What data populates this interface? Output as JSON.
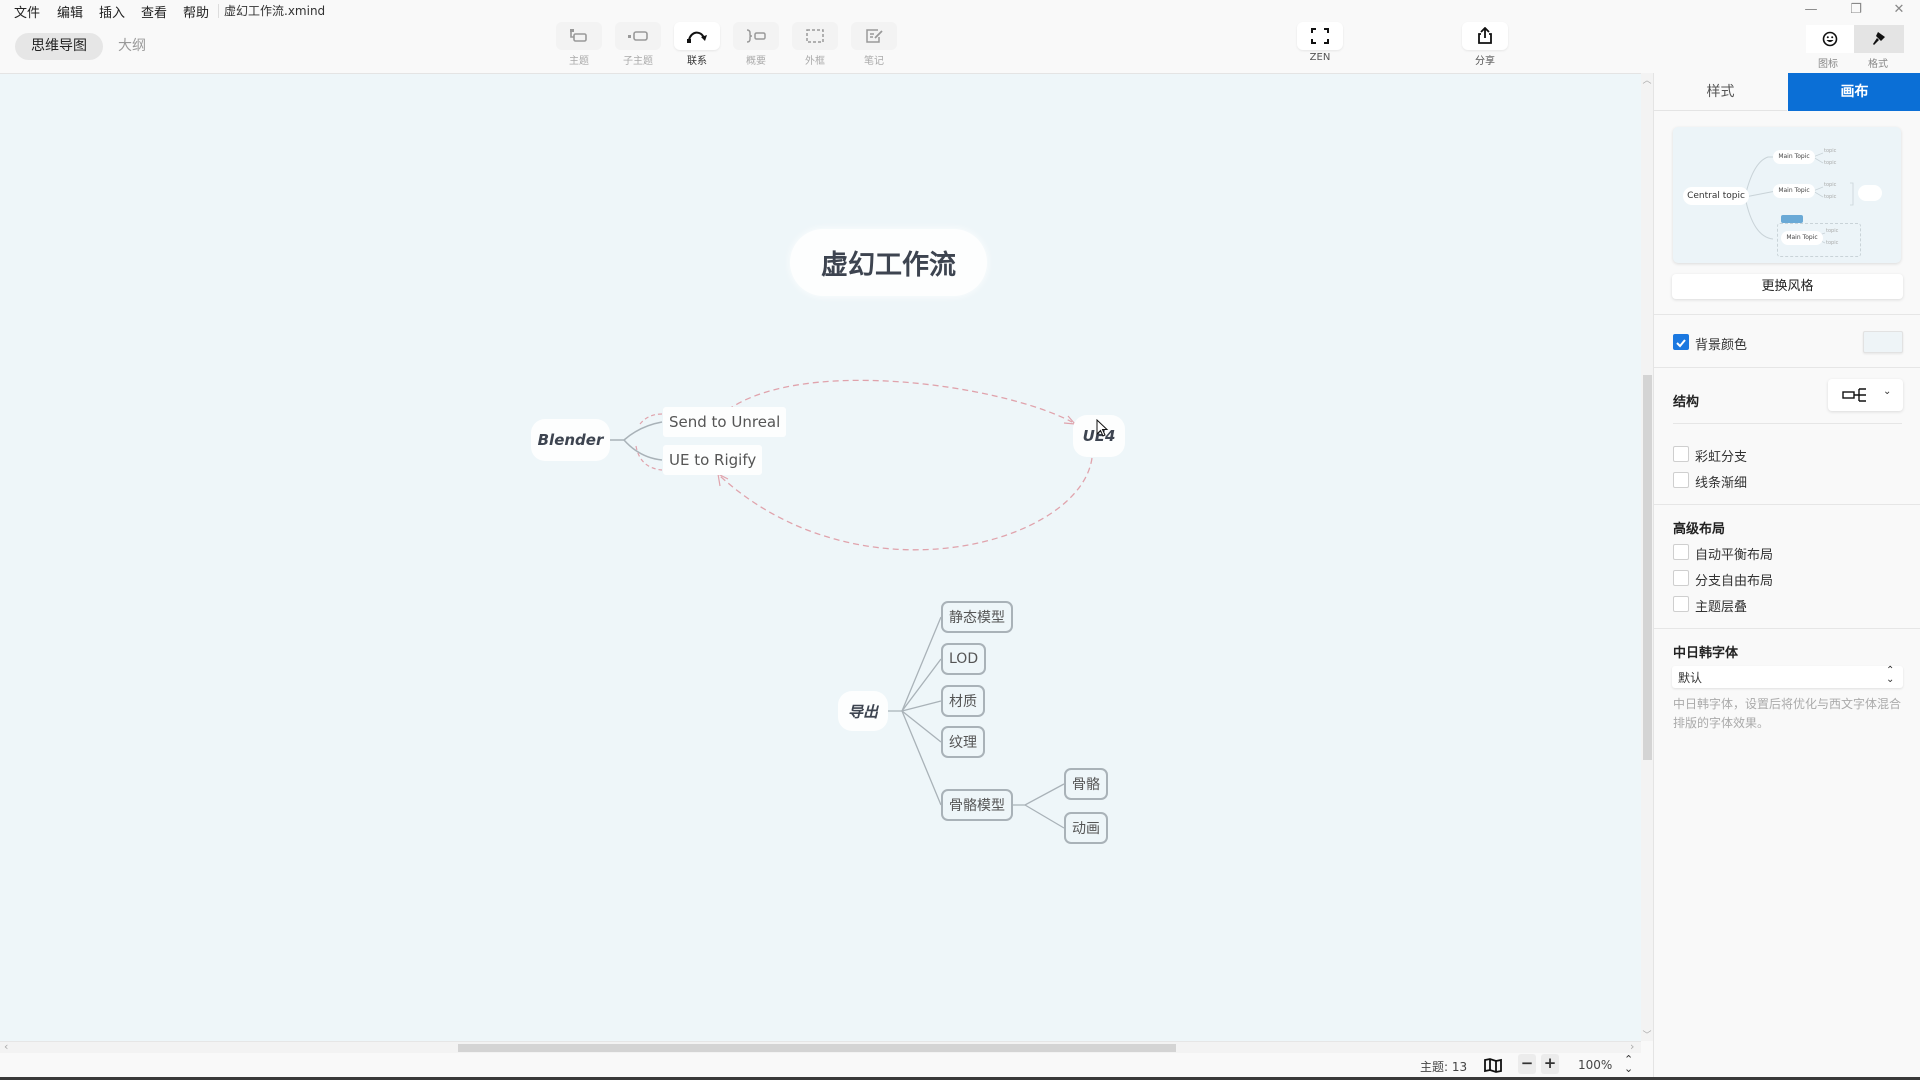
{
  "menubar": {
    "items": [
      "文件",
      "编辑",
      "插入",
      "查看",
      "帮助"
    ],
    "filename": "虚幻工作流.xmind",
    "window_controls": {
      "minimize": "—",
      "restore": "❐",
      "close": "✕"
    }
  },
  "view_tabs": {
    "mindmap": "思维导图",
    "outline": "大纲",
    "active": "mindmap"
  },
  "toolbar": {
    "items": [
      {
        "label": "主题",
        "icon": "topic-icon",
        "active": false
      },
      {
        "label": "子主题",
        "icon": "subtopic-icon",
        "active": false
      },
      {
        "label": "联系",
        "icon": "relationship-icon",
        "active": true
      },
      {
        "label": "概要",
        "icon": "summary-icon",
        "active": false
      },
      {
        "label": "外框",
        "icon": "boundary-icon",
        "active": false
      },
      {
        "label": "笔记",
        "icon": "note-icon",
        "active": false
      }
    ],
    "zen_label": "ZEN",
    "share_label": "分享",
    "icon_label": "图标",
    "format_label": "格式"
  },
  "mindmap": {
    "central_topic": "虚幻工作流",
    "floating_topics": {
      "blender": {
        "label": "Blender",
        "children": [
          "Send to Unreal",
          "UE to Rigify"
        ]
      },
      "ue4": {
        "label": "UE4"
      },
      "export": {
        "label": "导出",
        "children": [
          {
            "label": "静态模型"
          },
          {
            "label": "LOD"
          },
          {
            "label": "材质"
          },
          {
            "label": "纹理"
          },
          {
            "label": "骨骼模型",
            "children": [
              "骨骼",
              "动画"
            ]
          }
        ]
      }
    },
    "relationships": [
      {
        "from": "Send to Unreal",
        "to": "UE4",
        "style": "dashed",
        "color": "#e0a3ac"
      },
      {
        "from": "UE4",
        "to": "UE to Rigify",
        "style": "dashed",
        "color": "#e0a3ac"
      }
    ],
    "canvas_background": "#eef6f9"
  },
  "panel": {
    "tabs": {
      "style": "样式",
      "canvas": "画布",
      "active": "canvas"
    },
    "theme_preview": {
      "central": "Central topic",
      "main": "Main Topic",
      "sub": "topic"
    },
    "change_style_button": "更换风格",
    "background_color": {
      "label": "背景颜色",
      "checked": true,
      "color": "#eef6f9"
    },
    "structure": {
      "label": "结构"
    },
    "rainbow_branch": {
      "label": "彩虹分支",
      "checked": false
    },
    "tapered_lines": {
      "label": "线条渐细",
      "checked": false
    },
    "advanced_layout": {
      "title": "高级布局",
      "options": [
        {
          "label": "自动平衡布局",
          "checked": false
        },
        {
          "label": "分支自由布局",
          "checked": false
        },
        {
          "label": "主题层叠",
          "checked": false
        }
      ]
    },
    "cjk_font": {
      "title": "中日韩字体",
      "value": "默认",
      "description": "中日韩字体，设置后将优化与西文字体混合排版的字体效果。"
    }
  },
  "statusbar": {
    "topic_count_label": "主题: 13",
    "zoom_level": "100%",
    "zoom_out": "−",
    "zoom_in": "+"
  },
  "colors": {
    "accent": "#0b6fd6",
    "checkbox_on": "#1b78e0",
    "relationship": "#e0a3ac",
    "branch_line": "#a9b2b8"
  }
}
